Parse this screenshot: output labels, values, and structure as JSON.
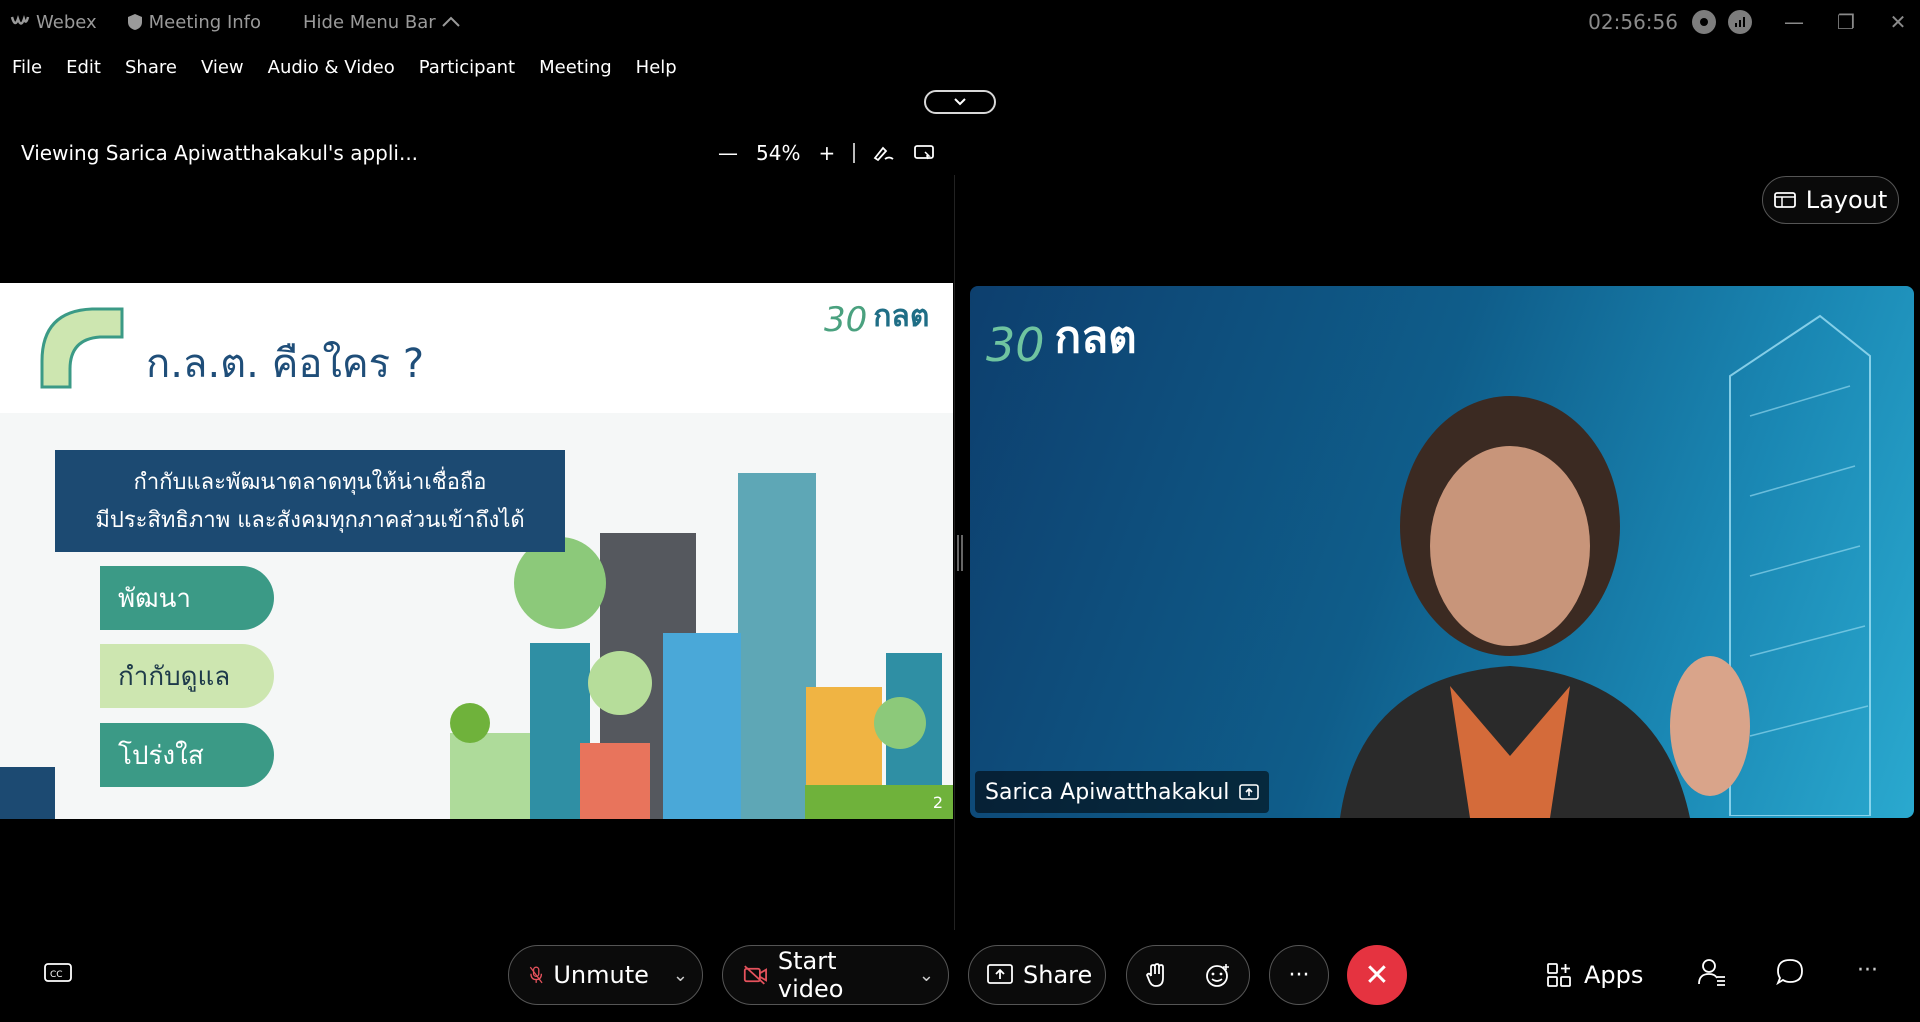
{
  "titlebar": {
    "app_name": "Webex",
    "meeting_info": "Meeting Info",
    "hide_menu": "Hide Menu Bar",
    "clock": "02:56:56"
  },
  "menu": [
    "File",
    "Edit",
    "Share",
    "View",
    "Audio & Video",
    "Participant",
    "Meeting",
    "Help"
  ],
  "share_header": {
    "viewing": "Viewing Sarica Apiwatthakakul's appli...",
    "zoom": "54%"
  },
  "slide": {
    "title": "ก.ล.ต. คือใคร ?",
    "band_line1": "กำกับและพัฒนาตลาดทุนให้น่าเชื่อถือ",
    "band_line2": "มีประสิทธิภาพ และสังคมทุกภาคส่วนเข้าถึงได้",
    "pill1": "พัฒนา",
    "pill2": "กำกับดูแล",
    "pill3": "โปร่งใส",
    "page_number": "2",
    "logo_text": "กลต",
    "anniv_text": "30"
  },
  "video": {
    "layout_label": "Layout",
    "participant_name": "Sarica Apiwatthakakul",
    "logo_text": "กลต",
    "anniv_text": "30"
  },
  "controls": {
    "unmute": "Unmute",
    "start_video": "Start video",
    "share": "Share",
    "apps": "Apps",
    "more": "···"
  },
  "colors": {
    "end_call": "#e53340",
    "slide_navy": "#1c4a72",
    "slide_teal": "#3b9a86"
  }
}
